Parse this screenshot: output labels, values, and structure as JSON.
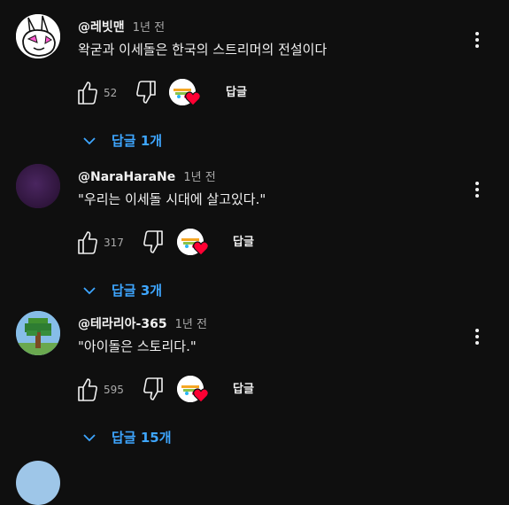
{
  "comments": [
    {
      "author": "@레빗맨",
      "time": "1년 전",
      "text": "왁굳과 이세돌은 한국의 스트리머의 전설이다",
      "likes": "52",
      "reply_label": "답글",
      "replies_label": "답글 1개"
    },
    {
      "author": "@NaraHaraNe",
      "time": "1년 전",
      "text": "\"우리는 이세돌 시대에 살고있다.\"",
      "likes": "317",
      "reply_label": "답글",
      "replies_label": "답글 3개"
    },
    {
      "author": "@테라리아-365",
      "time": "1년 전",
      "text": "\"아이돌은 스토리다.\"",
      "likes": "595",
      "reply_label": "답글",
      "replies_label": "답글 15개"
    }
  ],
  "icons": {
    "menu": "more-vert-icon",
    "like": "thumb-up-icon",
    "dislike": "thumb-down-icon",
    "heart": "heart-icon",
    "expand": "chevron-down-icon"
  },
  "colors": {
    "background": "#0f0f0f",
    "text": "#f1f1f1",
    "secondary_text": "#aaaaaa",
    "link": "#3ea6ff",
    "heart": "#ff0033"
  }
}
